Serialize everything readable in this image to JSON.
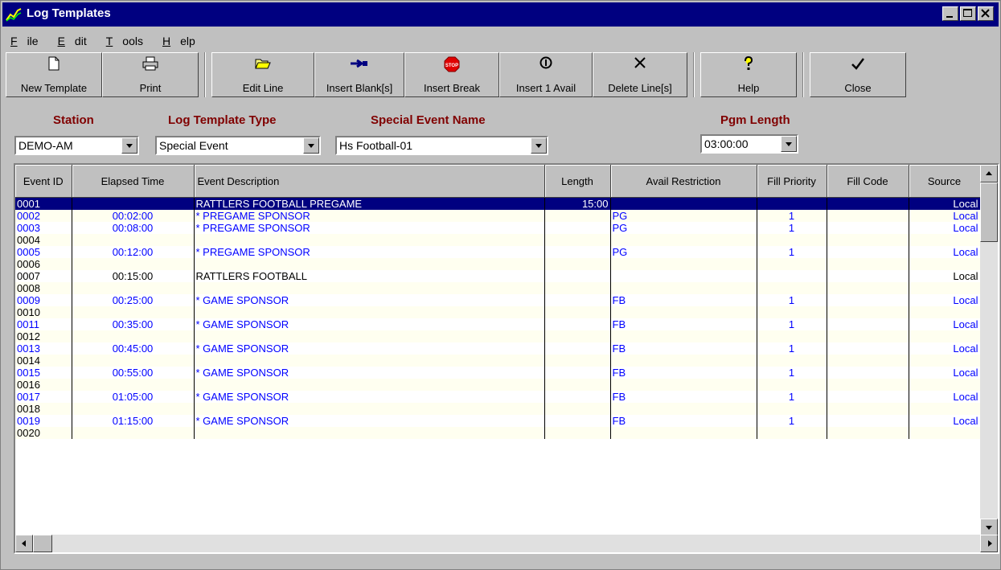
{
  "window": {
    "title": "Log Templates"
  },
  "menu": [
    {
      "label": "File",
      "underline": "F",
      "rest": "ile"
    },
    {
      "label": "Edit",
      "underline": "E",
      "rest": "dit"
    },
    {
      "label": "Tools",
      "underline": "T",
      "rest": "ools"
    },
    {
      "label": "Help",
      "underline": "H",
      "rest": "elp"
    }
  ],
  "toolbar": {
    "new_template": {
      "label": "New Template",
      "icon": "new-document-icon"
    },
    "print": {
      "label": "Print",
      "icon": "printer-icon"
    },
    "edit_line": {
      "label": "Edit Line",
      "icon": "open-folder-icon"
    },
    "insert_blank": {
      "label": "Insert Blank[s]",
      "icon": "arrow-insert-icon"
    },
    "insert_break": {
      "label": "Insert Break",
      "icon": "stop-sign-icon"
    },
    "insert_avail": {
      "label": "Insert 1 Avail",
      "icon": "circled-one-icon"
    },
    "delete_lines": {
      "label": "Delete Line[s]",
      "icon": "x-delete-icon"
    },
    "help": {
      "label": "Help",
      "icon": "question-key-icon"
    },
    "close": {
      "label": "Close",
      "icon": "checkmark-icon"
    }
  },
  "filters": {
    "station": {
      "label": "Station",
      "value": "DEMO-AM"
    },
    "template_type": {
      "label": "Log Template Type",
      "value": "Special Event"
    },
    "special_event": {
      "label": "Special Event Name",
      "value": "Hs Football-01"
    },
    "pgm_length": {
      "label": "Pgm Length",
      "value": "03:00:00"
    }
  },
  "table": {
    "headers": {
      "event_id": "Event ID",
      "elapsed": "Elapsed Time",
      "description": "Event Description",
      "length": "Length",
      "avail": "Avail Restriction",
      "fill_priority": "Fill Priority",
      "fill_code": "Fill Code",
      "source": "Source"
    },
    "rows": [
      {
        "id": "0001",
        "elapsed": "",
        "desc": "RATTLERS FOOTBALL PREGAME",
        "length": "15:00",
        "avail": "",
        "prio": "",
        "code": "",
        "source": "Local",
        "style": "sel"
      },
      {
        "id": "0002",
        "elapsed": "00:02:00",
        "desc": "* PREGAME SPONSOR",
        "length": "",
        "avail": "PG",
        "prio": "1",
        "code": "",
        "source": "Local",
        "style": "blue"
      },
      {
        "id": "0003",
        "elapsed": "00:08:00",
        "desc": "* PREGAME SPONSOR",
        "length": "",
        "avail": "PG",
        "prio": "1",
        "code": "",
        "source": "Local",
        "style": "blue"
      },
      {
        "id": "0004",
        "elapsed": "",
        "desc": "",
        "length": "",
        "avail": "",
        "prio": "",
        "code": "",
        "source": "",
        "style": ""
      },
      {
        "id": "0005",
        "elapsed": "00:12:00",
        "desc": "* PREGAME SPONSOR",
        "length": "",
        "avail": "PG",
        "prio": "1",
        "code": "",
        "source": "Local",
        "style": "blue"
      },
      {
        "id": "0006",
        "elapsed": "",
        "desc": "",
        "length": "",
        "avail": "",
        "prio": "",
        "code": "",
        "source": "",
        "style": ""
      },
      {
        "id": "0007",
        "elapsed": "00:15:00",
        "desc": "RATTLERS FOOTBALL",
        "length": "",
        "avail": "",
        "prio": "",
        "code": "",
        "source": "Local",
        "style": ""
      },
      {
        "id": "0008",
        "elapsed": "",
        "desc": "",
        "length": "",
        "avail": "",
        "prio": "",
        "code": "",
        "source": "",
        "style": ""
      },
      {
        "id": "0009",
        "elapsed": "00:25:00",
        "desc": "* GAME SPONSOR",
        "length": "",
        "avail": "FB",
        "prio": "1",
        "code": "",
        "source": "Local",
        "style": "blue"
      },
      {
        "id": "0010",
        "elapsed": "",
        "desc": "",
        "length": "",
        "avail": "",
        "prio": "",
        "code": "",
        "source": "",
        "style": ""
      },
      {
        "id": "0011",
        "elapsed": "00:35:00",
        "desc": "* GAME SPONSOR",
        "length": "",
        "avail": "FB",
        "prio": "1",
        "code": "",
        "source": "Local",
        "style": "blue"
      },
      {
        "id": "0012",
        "elapsed": "",
        "desc": "",
        "length": "",
        "avail": "",
        "prio": "",
        "code": "",
        "source": "",
        "style": ""
      },
      {
        "id": "0013",
        "elapsed": "00:45:00",
        "desc": "* GAME SPONSOR",
        "length": "",
        "avail": "FB",
        "prio": "1",
        "code": "",
        "source": "Local",
        "style": "blue"
      },
      {
        "id": "0014",
        "elapsed": "",
        "desc": "",
        "length": "",
        "avail": "",
        "prio": "",
        "code": "",
        "source": "",
        "style": ""
      },
      {
        "id": "0015",
        "elapsed": "00:55:00",
        "desc": "* GAME SPONSOR",
        "length": "",
        "avail": "FB",
        "prio": "1",
        "code": "",
        "source": "Local",
        "style": "blue"
      },
      {
        "id": "0016",
        "elapsed": "",
        "desc": "",
        "length": "",
        "avail": "",
        "prio": "",
        "code": "",
        "source": "",
        "style": ""
      },
      {
        "id": "0017",
        "elapsed": "01:05:00",
        "desc": "* GAME SPONSOR",
        "length": "",
        "avail": "FB",
        "prio": "1",
        "code": "",
        "source": "Local",
        "style": "blue"
      },
      {
        "id": "0018",
        "elapsed": "",
        "desc": "",
        "length": "",
        "avail": "",
        "prio": "",
        "code": "",
        "source": "",
        "style": ""
      },
      {
        "id": "0019",
        "elapsed": "01:15:00",
        "desc": "* GAME SPONSOR",
        "length": "",
        "avail": "FB",
        "prio": "1",
        "code": "",
        "source": "Local",
        "style": "blue"
      },
      {
        "id": "0020",
        "elapsed": "",
        "desc": "",
        "length": "",
        "avail": "",
        "prio": "",
        "code": "",
        "source": "",
        "style": ""
      }
    ]
  },
  "colors": {
    "titlebar": "#000080",
    "label": "#800000",
    "blue_text": "#0000ff",
    "selection": "#000080",
    "stripe": "#fffff0"
  }
}
